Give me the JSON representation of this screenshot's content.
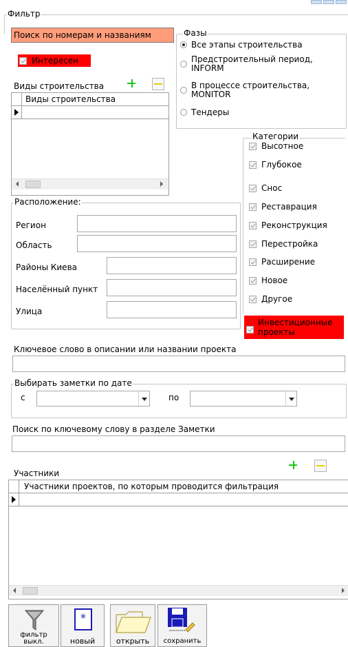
{
  "filter_group": {
    "title": "Фильтр"
  },
  "search_numbers_label": "Поиск по номерам и названиям",
  "interesting": {
    "label": "Интересен",
    "checked": true
  },
  "phases": {
    "title": "Фазы",
    "options": [
      {
        "label": "Все этапы строительства",
        "selected": true
      },
      {
        "label": "Предстроительный период,\nINFORM",
        "selected": false
      },
      {
        "label": "В процессе строительства,\nMONITOR",
        "selected": false
      },
      {
        "label": "Тендеры",
        "selected": false
      }
    ]
  },
  "construction_types": {
    "label": "Виды строительства",
    "column_header": "Виды строительства"
  },
  "categories": {
    "title": "Категории",
    "items": [
      {
        "label": "Высотное",
        "checked": true
      },
      {
        "label": "Глубокое",
        "checked": true
      },
      {
        "label": "Снос",
        "checked": true
      },
      {
        "label": "Реставрация",
        "checked": true
      },
      {
        "label": "Реконструкция",
        "checked": true
      },
      {
        "label": "Перестройка",
        "checked": true
      },
      {
        "label": "Расширение",
        "checked": true
      },
      {
        "label": "Новое",
        "checked": true
      },
      {
        "label": "Другое",
        "checked": true
      }
    ],
    "investment": {
      "label": "Инвестиционные проекты",
      "checked": true
    }
  },
  "location": {
    "title": "Расположение:",
    "fields": {
      "region": {
        "label": "Регион",
        "value": ""
      },
      "oblast": {
        "label": "Область",
        "value": ""
      },
      "kyiv_districts": {
        "label": "Районы Киева",
        "value": ""
      },
      "settlement": {
        "label": "Населённый пункт",
        "value": ""
      },
      "street": {
        "label": "Улица",
        "value": ""
      }
    }
  },
  "keyword": {
    "label": "Ключевое слово в описании или названии проекта",
    "value": ""
  },
  "notes_date": {
    "title": "Выбирать заметки по дате",
    "from_label": "с",
    "to_label": "по",
    "from_value": "",
    "to_value": ""
  },
  "notes_keyword": {
    "label": "Поиск по ключевому слову в разделе Заметки",
    "value": ""
  },
  "participants": {
    "label": "Участники",
    "column_header": "Участники проектов, по которым проводится фильтрация"
  },
  "toolbar": {
    "filter_label": "фильтр выкл.",
    "new_label": "новый",
    "open_label": "открыть",
    "save_label": "сохранить"
  },
  "colors": {
    "highlight_red": "#ff0000",
    "highlight_salmon": "#ff9d7a",
    "plus_green": "#19c419",
    "minus_yellow": "#e8d200"
  }
}
